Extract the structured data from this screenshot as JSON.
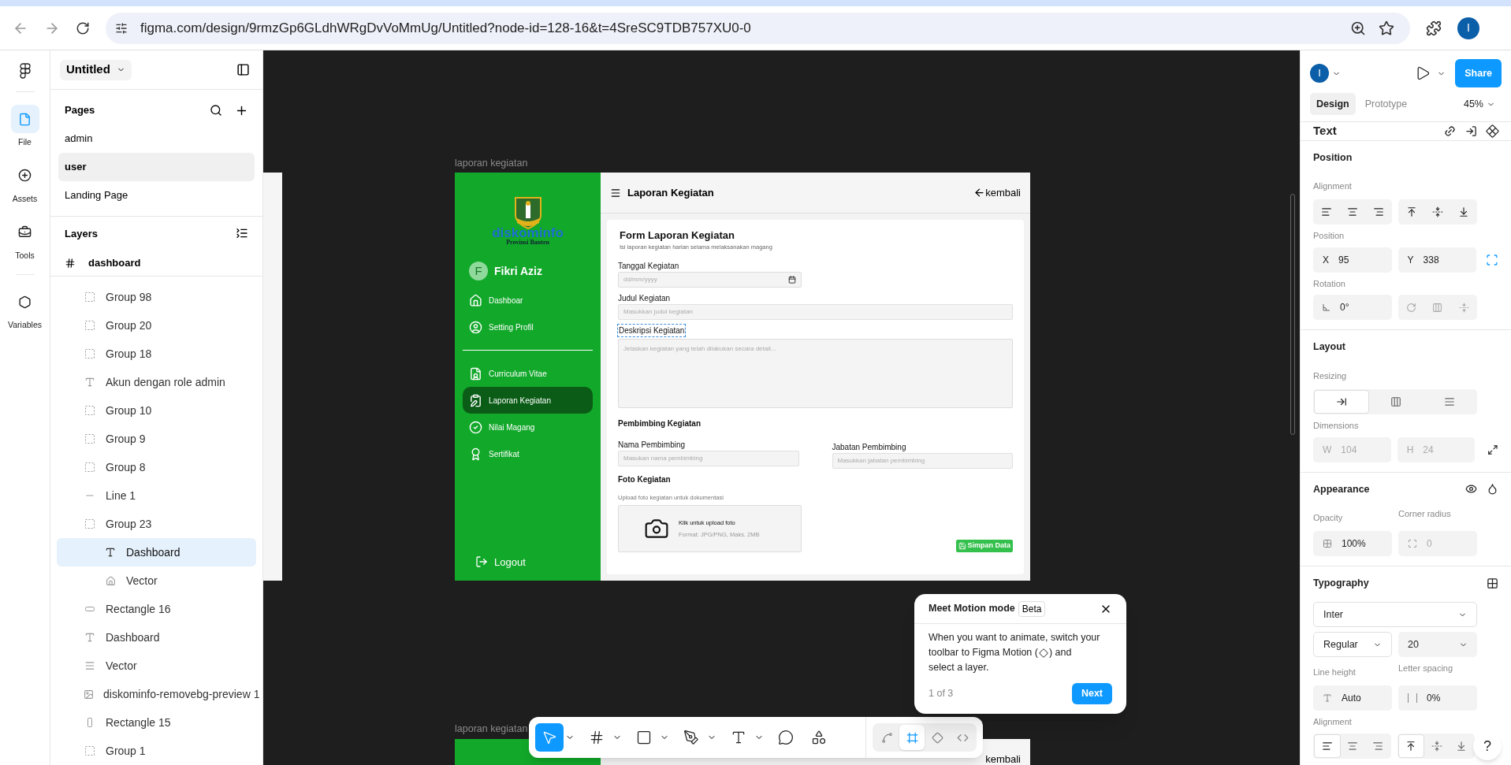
{
  "browser": {
    "url": "figma.com/design/9rmzGp6GLdhWRgDvVoMmUg/Untitled?node-id=128-16&t=4SreSC9TDB757XU0-0",
    "avatar": "I"
  },
  "rail": [
    {
      "kind": "file",
      "label": "File",
      "selected": true
    },
    {
      "kind": "assets",
      "label": "Assets",
      "selected": false
    },
    {
      "kind": "tools",
      "label": "Tools",
      "selected": false
    },
    {
      "kind": "variables",
      "label": "Variables",
      "selected": false
    }
  ],
  "file": {
    "name": "Untitled"
  },
  "pages": {
    "title": "Pages",
    "items": [
      {
        "label": "admin",
        "selected": false
      },
      {
        "label": "user",
        "selected": true
      },
      {
        "label": "Landing Page",
        "selected": false
      }
    ]
  },
  "layers": {
    "title": "Layers",
    "frame": "dashboard",
    "items": [
      {
        "kind": "group",
        "label": "Group 98",
        "selected": false
      },
      {
        "kind": "group",
        "label": "Group 20",
        "selected": false
      },
      {
        "kind": "group",
        "label": "Group 18",
        "selected": false
      },
      {
        "kind": "text",
        "label": "Akun dengan role admin",
        "selected": false
      },
      {
        "kind": "group",
        "label": "Group 10",
        "selected": false
      },
      {
        "kind": "group",
        "label": "Group 9",
        "selected": false
      },
      {
        "kind": "group",
        "label": "Group 8",
        "selected": false
      },
      {
        "kind": "line",
        "label": "Line 1",
        "selected": false
      },
      {
        "kind": "group",
        "label": "Group 23",
        "selected": false,
        "children": [
          {
            "kind": "text",
            "label": "Dashboard",
            "selected": true
          },
          {
            "kind": "home",
            "label": "Vector",
            "selected": false
          }
        ]
      },
      {
        "kind": "rect",
        "label": "Rectangle 16",
        "selected": false
      },
      {
        "kind": "text",
        "label": "Dashboard",
        "selected": false
      },
      {
        "kind": "menu",
        "label": "Vector",
        "selected": false
      },
      {
        "kind": "image",
        "label": "diskominfo-removebg-preview 1",
        "selected": false
      },
      {
        "kind": "tallrect",
        "label": "Rectangle 15",
        "selected": false
      },
      {
        "kind": "group",
        "label": "Group 1",
        "selected": false
      }
    ]
  },
  "canvas": {
    "frame_label": "laporan kegiatan",
    "second_frame_label": "laporan kegiatan",
    "second_back": "kembali"
  },
  "design": {
    "logo": {
      "name": "diskominfo",
      "region": "Provinsi Banten"
    },
    "user": {
      "initial": "F",
      "name": "Fikri Aziz"
    },
    "nav_groups": [
      [
        {
          "kind": "home",
          "label": "Dashboar",
          "selected": false
        },
        {
          "kind": "profile",
          "label": "Setting Profil",
          "selected": false
        }
      ],
      [
        {
          "kind": "cv",
          "label": "Curriculum Vitae",
          "selected": false
        },
        {
          "kind": "report",
          "label": "Laporan Kegiatan",
          "selected": true
        },
        {
          "kind": "grade",
          "label": "Nilai Magang",
          "selected": false
        },
        {
          "kind": "certificate",
          "label": "Sertifikat",
          "selected": false
        }
      ]
    ],
    "logout": "Logout",
    "header": {
      "title": "Laporan Kegiatan",
      "back": "kembali"
    },
    "form": {
      "title": "Form Laporan Kegiatan",
      "subtitle": "Isi laporan kegiatan harian selama melaksanakan magang",
      "date": {
        "label": "Tanggal Kegiatan",
        "placeholder": "dd/mm/yyyy"
      },
      "judul": {
        "label": "Judul Kegiatan",
        "placeholder": "Masukkan judul kegiatan"
      },
      "deskripsi": {
        "label": "Deskripsi Kegiatan",
        "placeholder": "Jelaskan kegiatan yang telah dilakukan secara detail...",
        "selected": true
      },
      "pembimbing_title": "Pembimbing Kegiatan",
      "nama": {
        "label": "Nama Pembimbing",
        "placeholder": "Masukan nama pembimbing"
      },
      "jabatan": {
        "label": "Jabatan Pembimbing",
        "placeholder": "Masukkan jabatan pembimbing"
      },
      "foto_title": "Foto Kegiatan",
      "foto_hint": "Upload foto kegiatan untuk dokumentasi",
      "upload": {
        "title": "Klik untuk upload foto",
        "format": "Format: JPG/PNG, Maks. 2MB"
      },
      "save": "Simpan Data"
    }
  },
  "toolbar": {
    "tools": [
      {
        "kind": "move",
        "selected": true,
        "caret": true
      },
      {
        "kind": "frame",
        "selected": false,
        "caret": true
      },
      {
        "kind": "shape",
        "selected": false,
        "caret": true
      },
      {
        "kind": "pen",
        "selected": false,
        "caret": true
      },
      {
        "kind": "text",
        "selected": false,
        "caret": true
      },
      {
        "kind": "comment",
        "selected": false
      },
      {
        "kind": "actions",
        "selected": false
      }
    ],
    "modes": [
      {
        "kind": "draw",
        "selected": false
      },
      {
        "kind": "design",
        "selected": true
      },
      {
        "kind": "motion",
        "selected": false
      },
      {
        "kind": "dev",
        "selected": false
      }
    ]
  },
  "popup": {
    "title": "Meet Motion mode",
    "badge": "Beta",
    "body_line1": "When you want to animate, switch your",
    "body_before": "toolbar to Figma Motion (",
    "body_after": ") and",
    "body_line3": "select a layer.",
    "step": "1 of 3",
    "next": "Next"
  },
  "inspector": {
    "avatar": "I",
    "share": "Share",
    "tabs": [
      {
        "label": "Design",
        "selected": true
      },
      {
        "label": "Prototype",
        "selected": false
      }
    ],
    "zoom": "45%",
    "selection": "Text",
    "position": {
      "title": "Position",
      "alignment_label": "Alignment",
      "position_label": "Position",
      "x": {
        "label": "X",
        "value": "95"
      },
      "y": {
        "label": "Y",
        "value": "338"
      },
      "rotation_label": "Rotation",
      "rotation": "0°"
    },
    "layout": {
      "title": "Layout",
      "resizing_label": "Resizing",
      "resizing": [
        {
          "kind": "fixed",
          "selected": true
        },
        {
          "kind": "fill",
          "selected": false
        },
        {
          "kind": "hug",
          "selected": false
        }
      ],
      "dimensions_label": "Dimensions",
      "w": {
        "label": "W",
        "value": "104"
      },
      "h": {
        "label": "H",
        "value": "24"
      },
      "disabled": true
    },
    "appearance": {
      "title": "Appearance",
      "opacity_label": "Opacity",
      "opacity": "100%",
      "corner_label": "Corner radius",
      "corner": "0"
    },
    "typography": {
      "title": "Typography",
      "font": "Inter",
      "weight": "Regular",
      "size": "20",
      "line_height_label": "Line height",
      "line_height": "Auto",
      "letter_spacing_label": "Letter spacing",
      "letter_spacing": "0%",
      "alignment_label": "Alignment",
      "h_align": [
        {
          "kind": "left",
          "selected": true
        },
        {
          "kind": "center",
          "selected": false
        },
        {
          "kind": "right",
          "selected": false
        }
      ],
      "v_align": [
        {
          "kind": "top",
          "selected": true
        },
        {
          "kind": "middle",
          "selected": false
        },
        {
          "kind": "bottom",
          "selected": false
        }
      ]
    },
    "help": "?"
  }
}
